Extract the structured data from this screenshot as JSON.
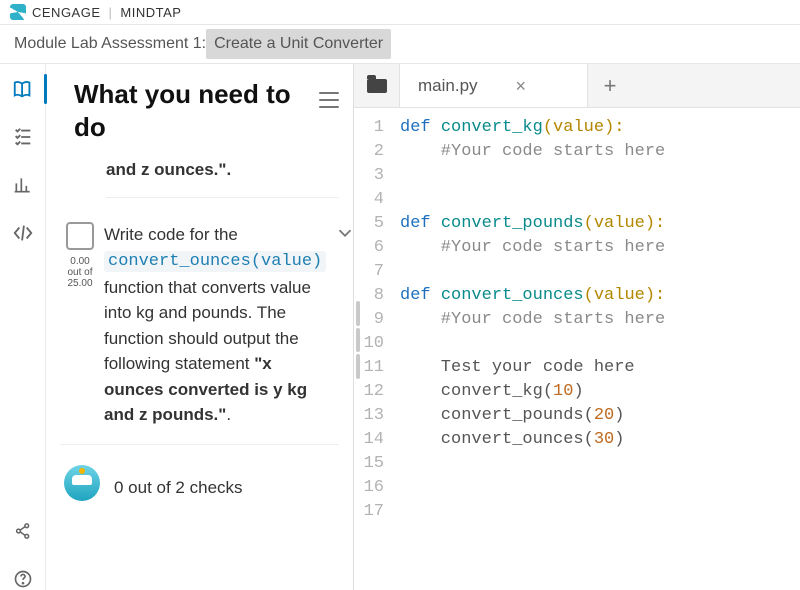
{
  "brand": {
    "name": "CENGAGE",
    "product": "MINDTAP"
  },
  "breadcrumb": {
    "prefix": "Module Lab Assessment 1: ",
    "highlight": "Create a Unit Converter"
  },
  "panel": {
    "heading": "What you need to do",
    "snippet_tail": "and z ounces.\".",
    "task": {
      "score_top": "0.00",
      "score_mid": "out of",
      "score_bot": "25.00",
      "lead": "Write code for the ",
      "chip": "convert_ounces(value)",
      "body_after": "function that converts value into kg and pounds. The function should output the following statement ",
      "bold": "\"x ounces converted is y kg and z pounds.\"",
      "tail": "."
    },
    "bot_msg": "0 out of 2 checks"
  },
  "editor": {
    "tab": "main.py",
    "lines": [
      [
        {
          "t": "def ",
          "c": "kw"
        },
        {
          "t": "convert_kg",
          "c": "fn"
        },
        {
          "t": "(",
          "c": "pn"
        },
        {
          "t": "value",
          "c": "id"
        },
        {
          "t": "):",
          "c": "pn"
        }
      ],
      [
        {
          "t": "    #Your code starts here",
          "c": "cm"
        }
      ],
      [],
      [],
      [
        {
          "t": "def ",
          "c": "kw"
        },
        {
          "t": "convert_pounds",
          "c": "fn"
        },
        {
          "t": "(",
          "c": "pn"
        },
        {
          "t": "value",
          "c": "id"
        },
        {
          "t": "):",
          "c": "pn"
        }
      ],
      [
        {
          "t": "    #Your code starts here",
          "c": "cm"
        }
      ],
      [],
      [
        {
          "t": "def ",
          "c": "kw"
        },
        {
          "t": "convert_ounces",
          "c": "fn"
        },
        {
          "t": "(",
          "c": "pn"
        },
        {
          "t": "value",
          "c": "id"
        },
        {
          "t": "):",
          "c": "pn"
        }
      ],
      [
        {
          "t": "    #Your code starts here",
          "c": "cm"
        }
      ],
      [],
      [
        {
          "t": "    Test your code here",
          "c": ""
        }
      ],
      [
        {
          "t": "    convert_kg(",
          "c": ""
        },
        {
          "t": "10",
          "c": "num"
        },
        {
          "t": ")",
          "c": ""
        }
      ],
      [
        {
          "t": "    convert_pounds(",
          "c": ""
        },
        {
          "t": "20",
          "c": "num"
        },
        {
          "t": ")",
          "c": ""
        }
      ],
      [
        {
          "t": "    convert_ounces(",
          "c": ""
        },
        {
          "t": "30",
          "c": "num"
        },
        {
          "t": ")",
          "c": ""
        }
      ],
      [],
      [],
      []
    ]
  }
}
